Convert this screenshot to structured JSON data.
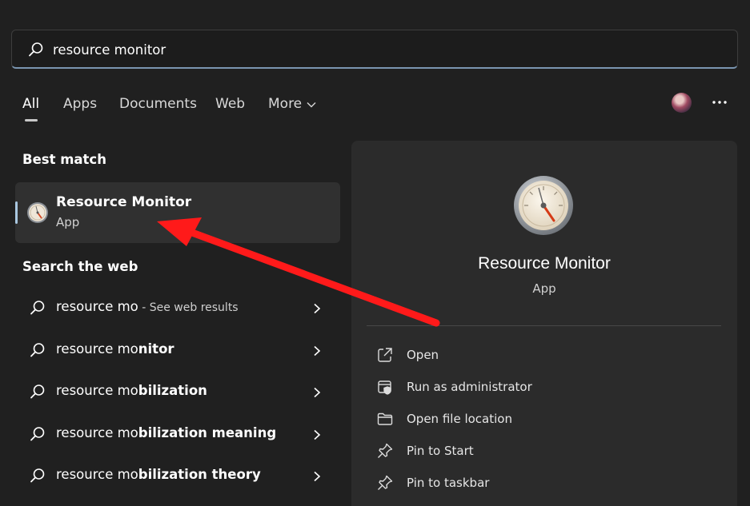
{
  "search": {
    "value": "resource monitor",
    "placeholder": ""
  },
  "tabs": [
    {
      "label": "All",
      "active": true
    },
    {
      "label": "Apps"
    },
    {
      "label": "Documents"
    },
    {
      "label": "Web"
    },
    {
      "label": "More"
    }
  ],
  "best_match": {
    "section_title": "Best match",
    "title": "Resource Monitor",
    "subtitle": "App"
  },
  "web_search": {
    "section_title": "Search the web",
    "items": [
      {
        "prefix": "resource mo",
        "suffix": "",
        "hint": " - See web results"
      },
      {
        "prefix": "resource mo",
        "suffix": "nitor",
        "hint": ""
      },
      {
        "prefix": "resource mo",
        "suffix": "bilization",
        "hint": ""
      },
      {
        "prefix": "resource mo",
        "suffix": "bilization meaning",
        "hint": ""
      },
      {
        "prefix": "resource mo",
        "suffix": "bilization theory",
        "hint": ""
      }
    ]
  },
  "details": {
    "title": "Resource Monitor",
    "subtitle": "App",
    "actions": [
      {
        "label": "Open",
        "icon": "open-external-icon"
      },
      {
        "label": "Run as administrator",
        "icon": "shield-admin-icon"
      },
      {
        "label": "Open file location",
        "icon": "folder-icon"
      },
      {
        "label": "Pin to Start",
        "icon": "pin-icon"
      },
      {
        "label": "Pin to taskbar",
        "icon": "pin-icon"
      }
    ]
  },
  "colors": {
    "background": "#202020",
    "panel": "#2b2b2b",
    "selected_card": "#303030",
    "accent": "#a9c7e0",
    "annotation_arrow": "#ff1a1a"
  }
}
